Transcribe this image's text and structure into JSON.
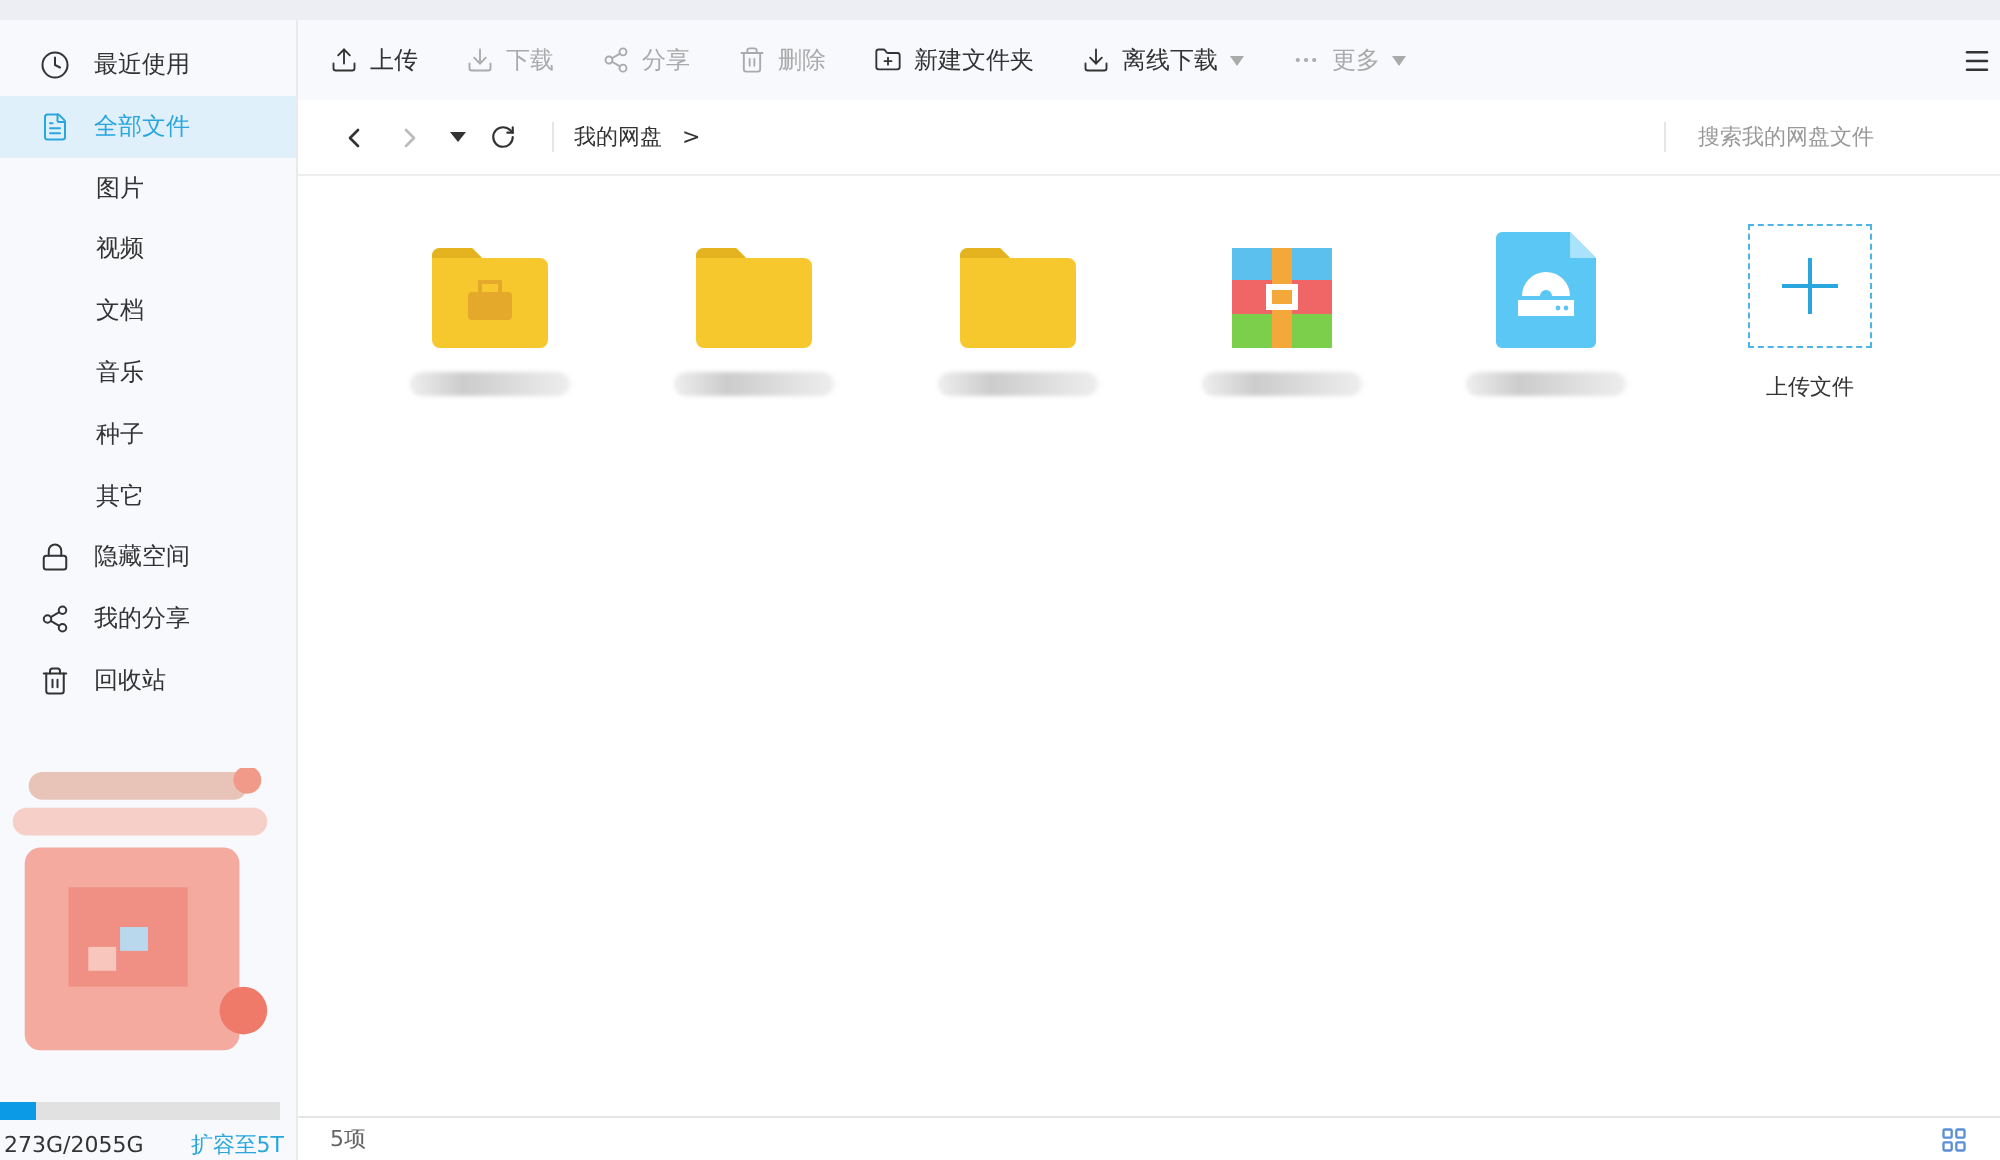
{
  "sidebar": {
    "items": [
      {
        "label": "最近使用",
        "selected": false
      },
      {
        "label": "全部文件",
        "selected": true,
        "children": [
          {
            "label": "图片",
            "selected": false
          },
          {
            "label": "视频",
            "selected": false
          },
          {
            "label": "文档",
            "selected": false
          },
          {
            "label": "音乐",
            "selected": false
          },
          {
            "label": "种子",
            "selected": false
          },
          {
            "label": "其它",
            "selected": false
          }
        ]
      },
      {
        "label": "隐藏空间",
        "selected": false
      },
      {
        "label": "我的分享",
        "selected": false
      },
      {
        "label": "回收站",
        "selected": false
      }
    ],
    "storage": {
      "level": 0.13,
      "usage": "273G/2055G",
      "upgrade": "扩容至5T"
    }
  },
  "toolbar": [
    {
      "label": "上传",
      "disabled": false,
      "dropdown": false
    },
    {
      "label": "下载",
      "disabled": true,
      "dropdown": false
    },
    {
      "label": "分享",
      "disabled": true,
      "dropdown": false
    },
    {
      "label": "删除",
      "disabled": true,
      "dropdown": false
    },
    {
      "label": "新建文件夹",
      "disabled": false,
      "dropdown": false
    },
    {
      "label": "离线下载",
      "disabled": false,
      "dropdown": true
    },
    {
      "label": "更多",
      "disabled": true,
      "dropdown": true
    }
  ],
  "path": {
    "breadcrumb": "我的网盘",
    "separator": ">"
  },
  "search": {
    "placeholder": "搜索我的网盘文件"
  },
  "files": [
    {
      "kind": "folder-tools"
    },
    {
      "kind": "folder"
    },
    {
      "kind": "folder"
    },
    {
      "kind": "archive"
    },
    {
      "kind": "disc"
    },
    {
      "kind": "upload",
      "label": "上传文件"
    }
  ],
  "status_bar": {
    "count": "5项"
  }
}
